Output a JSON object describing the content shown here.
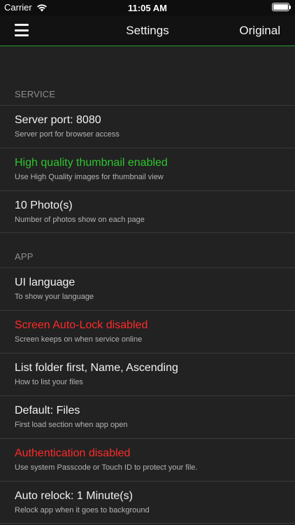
{
  "status_bar": {
    "carrier": "Carrier",
    "time": "11:05 AM"
  },
  "nav": {
    "title": "Settings",
    "right_label": "Original"
  },
  "sections": {
    "service": {
      "header": "SERVICE",
      "rows": [
        {
          "title": "Server port: 8080",
          "subtitle": "Server port for browser access"
        },
        {
          "title": "High quality thumbnail enabled",
          "subtitle": "Use High Quality images for thumbnail view"
        },
        {
          "title": "10 Photo(s)",
          "subtitle": "Number of photos show on each page"
        }
      ]
    },
    "app": {
      "header": "APP",
      "rows": [
        {
          "title": "UI language",
          "subtitle": "To show your language"
        },
        {
          "title": "Screen Auto-Lock disabled",
          "subtitle": "Screen keeps on when service online"
        },
        {
          "title": "List folder first, Name, Ascending",
          "subtitle": "How to list your files"
        },
        {
          "title": "Default: Files",
          "subtitle": "First load section when app open"
        },
        {
          "title": "Authentication disabled",
          "subtitle": "Use system Passcode or Touch ID to protect your file."
        },
        {
          "title": "Auto relock: 1 Minute(s)",
          "subtitle": "Relock app when it goes to background"
        }
      ]
    }
  },
  "colors": {
    "accent_green": "#2ec42e",
    "warning_red": "#ff2a2a",
    "background": "#222222"
  }
}
